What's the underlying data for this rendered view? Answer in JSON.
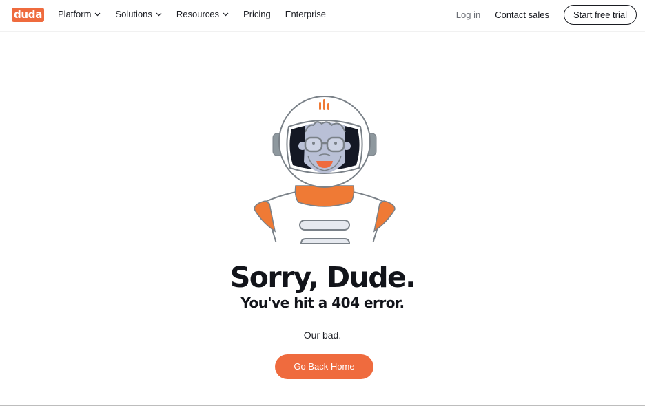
{
  "header": {
    "logo_text": "duda",
    "nav": [
      {
        "label": "Platform",
        "has_dropdown": true
      },
      {
        "label": "Solutions",
        "has_dropdown": true
      },
      {
        "label": "Resources",
        "has_dropdown": true
      },
      {
        "label": "Pricing",
        "has_dropdown": false
      },
      {
        "label": "Enterprise",
        "has_dropdown": false
      }
    ],
    "login_label": "Log in",
    "contact_label": "Contact sales",
    "trial_label": "Start free trial"
  },
  "main": {
    "illustration": "astronaut-icon",
    "title": "Sorry, Dude.",
    "subtitle": "You've hit a 404 error.",
    "message": "Our bad.",
    "home_button_label": "Go Back Home"
  },
  "colors": {
    "brand": "#ef6b3e",
    "text": "#14161c",
    "muted": "#6b6e75",
    "suit_outline": "#7a8188",
    "face": "#b9c0d6"
  }
}
